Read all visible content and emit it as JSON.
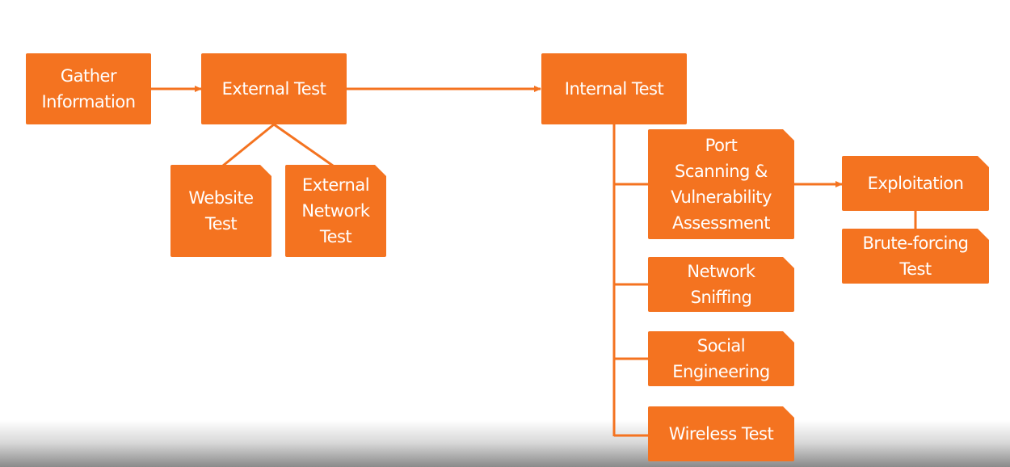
{
  "diagram": {
    "accent_color": "#f47320",
    "nodes": {
      "gather": "Gather\nInformation",
      "external": "External Test",
      "internal": "Internal Test",
      "website": "Website\nTest",
      "external_network": "External\nNetwork\nTest",
      "port_scanning": "Port\nScanning &\nVulnerability\nAssessment",
      "exploitation": "Exploitation",
      "brute_forcing": "Brute-forcing\nTest",
      "network_sniffing": "Network\nSniffing",
      "social_engineering": "Social\nEngineering",
      "wireless": "Wireless Test"
    },
    "edges": [
      {
        "from": "gather",
        "to": "external",
        "type": "arrow"
      },
      {
        "from": "external",
        "to": "internal",
        "type": "arrow"
      },
      {
        "from": "external",
        "to": "website",
        "type": "line"
      },
      {
        "from": "external",
        "to": "external_network",
        "type": "line"
      },
      {
        "from": "internal",
        "to": "port_scanning",
        "type": "line"
      },
      {
        "from": "internal",
        "to": "network_sniffing",
        "type": "line"
      },
      {
        "from": "internal",
        "to": "social_engineering",
        "type": "line"
      },
      {
        "from": "internal",
        "to": "wireless",
        "type": "line"
      },
      {
        "from": "port_scanning",
        "to": "exploitation",
        "type": "arrow"
      },
      {
        "from": "exploitation",
        "to": "brute_forcing",
        "type": "line"
      }
    ]
  }
}
